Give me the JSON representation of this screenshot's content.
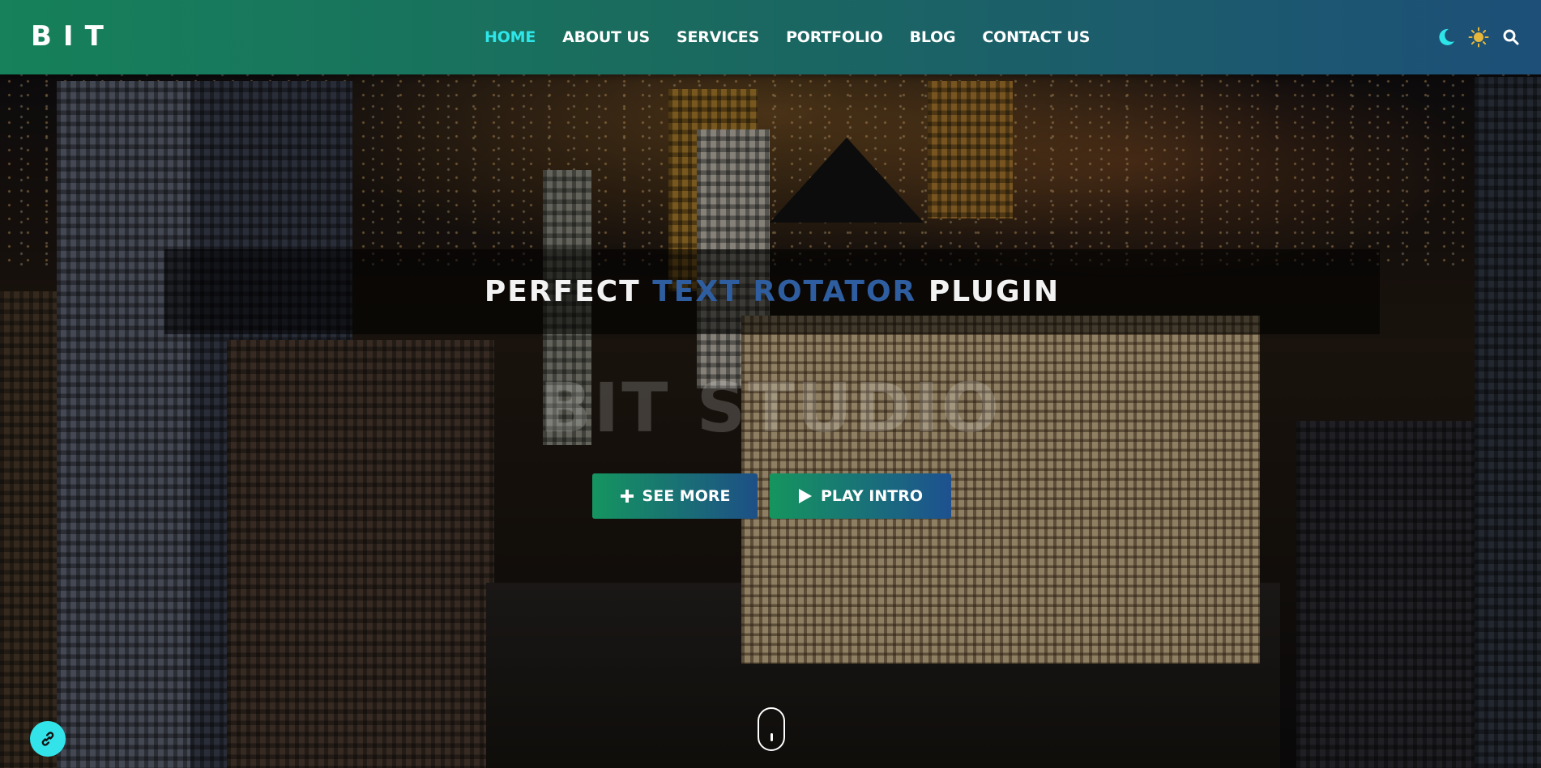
{
  "header": {
    "logo": "BIT",
    "nav": [
      {
        "label": "HOME",
        "active": true
      },
      {
        "label": "ABOUT US",
        "active": false
      },
      {
        "label": "SERVICES",
        "active": false
      },
      {
        "label": "PORTFOLIO",
        "active": false
      },
      {
        "label": "BLOG",
        "active": false
      },
      {
        "label": "CONTACT US",
        "active": false
      }
    ],
    "icons": [
      "moon-icon",
      "sun-icon",
      "search-icon"
    ]
  },
  "hero": {
    "rotator": {
      "prefix": "PERFECT",
      "highlight": "TEXT ROTATOR",
      "suffix": "PLUGIN"
    },
    "studio_title": "BIT STUDIO",
    "buttons": {
      "see_more": "SEE MORE",
      "play_intro": "PLAY INTRO"
    }
  },
  "colors": {
    "accent_cyan": "#2ee6ea",
    "header_gradient_start": "#16815a",
    "header_gradient_end": "#1d4f78",
    "rotator_highlight": "#2f5ea0",
    "moon_icon": "#2ee6ea",
    "sun_icon": "#e6b73a"
  }
}
